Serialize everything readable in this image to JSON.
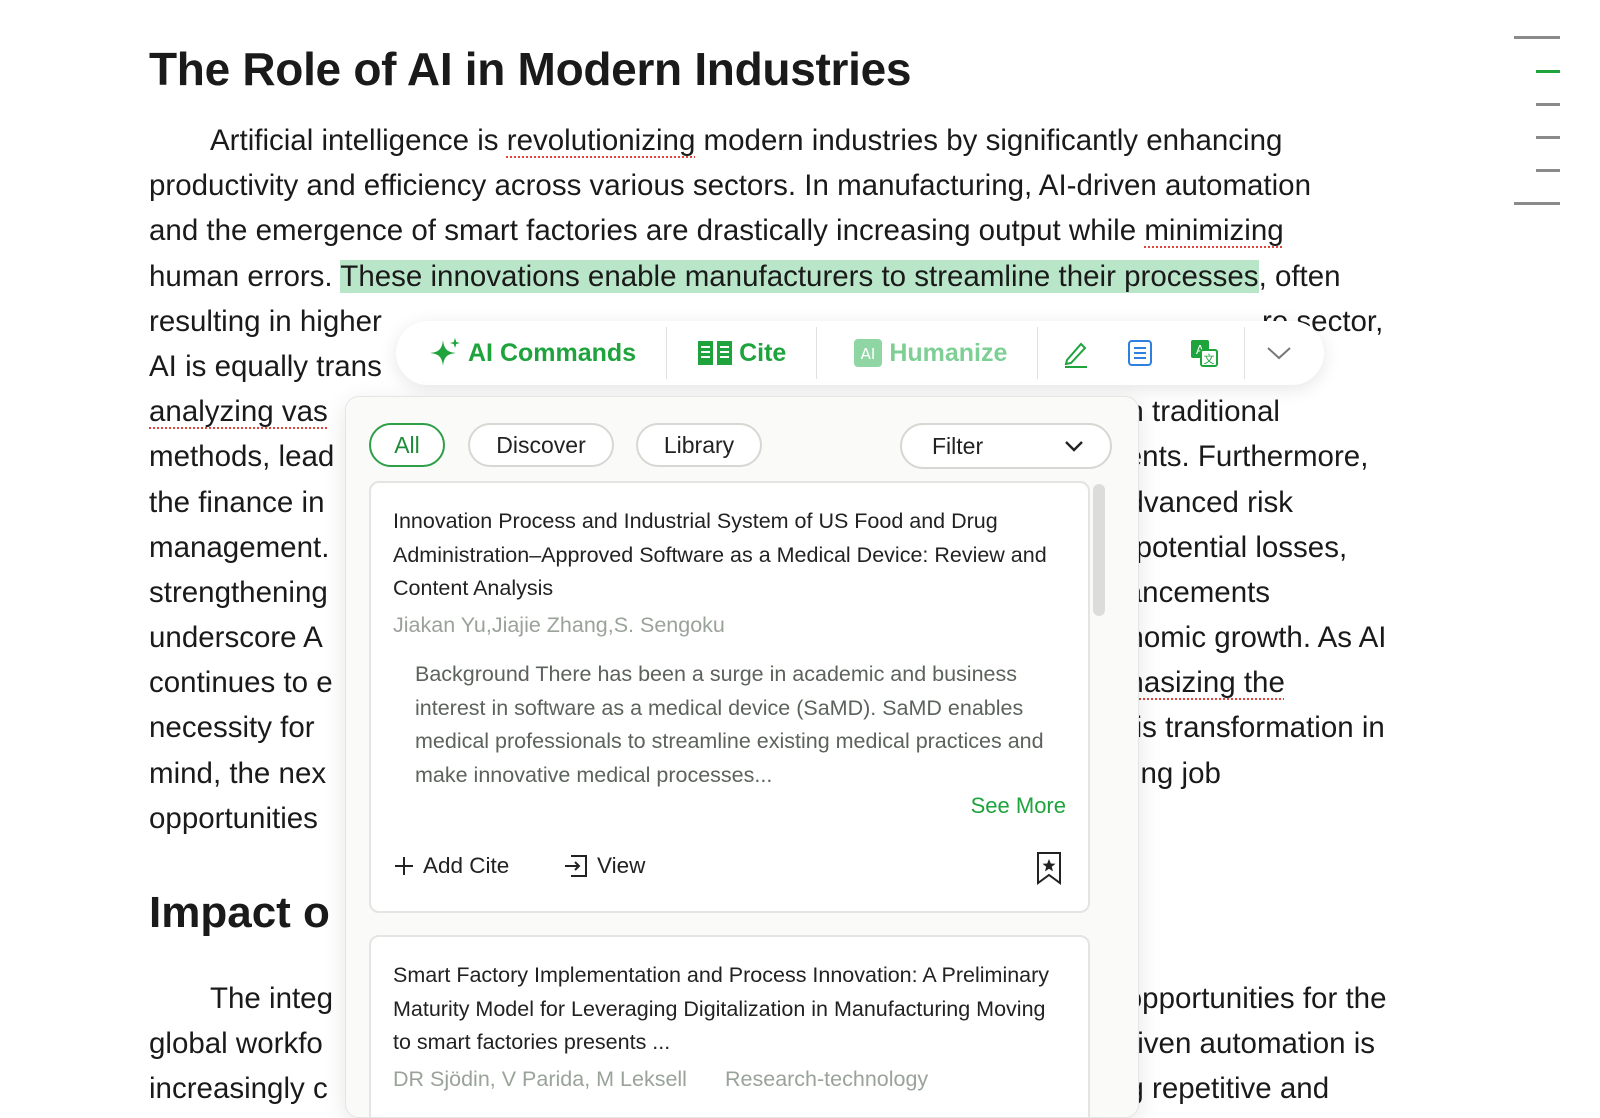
{
  "document": {
    "title": "The Role of AI in Modern Industries",
    "para1": [
      {
        "pre": "Artificial intelligence is ",
        "spell": "revolutionizing",
        "post": " modern industries by significantly enhancing"
      },
      {
        "text": "productivity and efficiency across various sectors. In manufacturing, AI-driven automation"
      },
      {
        "pre": "and the emergence of smart factories are drastically increasing output while ",
        "spell": "minimizing",
        "post": ""
      },
      {
        "pre": "human errors. ",
        "hl": "These innovations enable manufacturers to streamline their processes",
        "post": ", often"
      },
      {
        "left": "resulting in higher",
        "right": "re sector,"
      },
      {
        "left": "AI is equally trans",
        "right": ""
      },
      {
        "left": "analyzing vas",
        "right": "an traditional"
      },
      {
        "left": "methods, lead",
        "right": "tients. Furthermore,"
      },
      {
        "left": "the finance in",
        "right": "advanced risk"
      },
      {
        "left": "management.",
        "right": "e potential losses,"
      },
      {
        "left": "strengthening",
        "right": "vancements"
      },
      {
        "left": "underscore A",
        "right": "onomic growth. As AI"
      },
      {
        "left": "continues to e",
        "right": "phasizing the"
      },
      {
        "left": "necessity for",
        "right": "this transformation in"
      },
      {
        "left": "mind, the nex",
        "right": "cting job"
      },
      {
        "left": "opportunities",
        "right": ""
      }
    ],
    "heading2": "Impact o",
    "para2": [
      {
        "left": "The integ",
        "right": "l opportunities for the"
      },
      {
        "left": "global workfo",
        "right": "driven automation is"
      },
      {
        "left": "increasingly c",
        "right": "ng repetitive and"
      }
    ]
  },
  "toolbar": {
    "ai_commands": "AI Commands",
    "cite": "Cite",
    "humanize": "Humanize"
  },
  "panel": {
    "tabs": [
      "All",
      "Discover",
      "Library"
    ],
    "filter_label": "Filter",
    "cards": [
      {
        "title": "Innovation Process and Industrial System of US Food and Drug Administration–Approved Software as a Medical Device: Review and Content Analysis",
        "authors": "Jiakan Yu,Jiajie Zhang,S. Sengoku",
        "abstract": "Background There has been a surge in academic and business interest in software as a medical device (SaMD). SaMD enables medical professionals to streamline existing medical practices and make innovative medical processes...",
        "see_more": "See More",
        "add_cite": "Add Cite",
        "view": "View"
      },
      {
        "title": "Smart Factory Implementation and Process Innovation: A Preliminary Maturity Model for Leveraging Digitalization in Manufacturing Moving to smart factories presents ...",
        "authors": "DR Sjödin, V Parida, M Leksell",
        "journal": "Research-technology"
      }
    ]
  },
  "colors": {
    "accent": "#1fa33d",
    "highlight": "#b9e6c9",
    "spellcheck": "#e0433a"
  }
}
